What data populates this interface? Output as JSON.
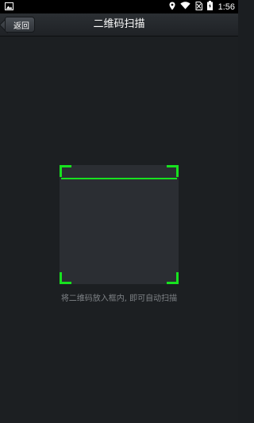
{
  "status_bar": {
    "time": "1:56",
    "icons": [
      "image-icon",
      "location-icon",
      "wifi-icon",
      "no-sim-icon",
      "battery-icon"
    ]
  },
  "header": {
    "back_label": "返回",
    "title": "二维码扫描"
  },
  "scanner": {
    "hint": "将二维码放入框内, 即可自动扫描",
    "accent_color": "#17e21f"
  }
}
